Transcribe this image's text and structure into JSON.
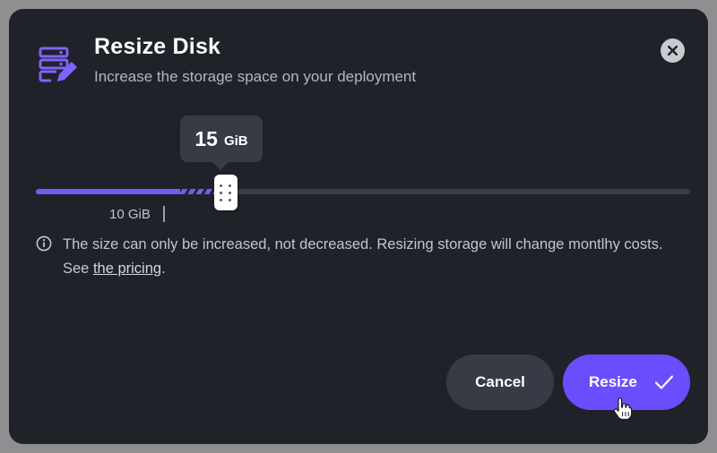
{
  "dialog": {
    "title": "Resize Disk",
    "subtitle": "Increase the storage space on your deployment",
    "header_icon": "storage-edit-icon",
    "close_icon": "close-icon"
  },
  "slider": {
    "selected_value": "15",
    "selected_unit": "GiB",
    "current_label": "10 GiB",
    "current_fraction": 0.22,
    "selected_fraction": 0.29
  },
  "info": {
    "icon": "info-icon",
    "text": "The size can only be increased, not decreased. Resizing storage will change montlhy costs. See ",
    "link_text": "the pricing",
    "suffix": "."
  },
  "buttons": {
    "cancel_label": "Cancel",
    "resize_label": "Resize",
    "resize_icon": "check-icon"
  },
  "colors": {
    "background": "#20222a",
    "accent": "#6a4dfc",
    "track": "#3a3d47",
    "fill": "#6f5cf2",
    "secondary_button": "#383b45",
    "close_button": "#c9cacf"
  }
}
